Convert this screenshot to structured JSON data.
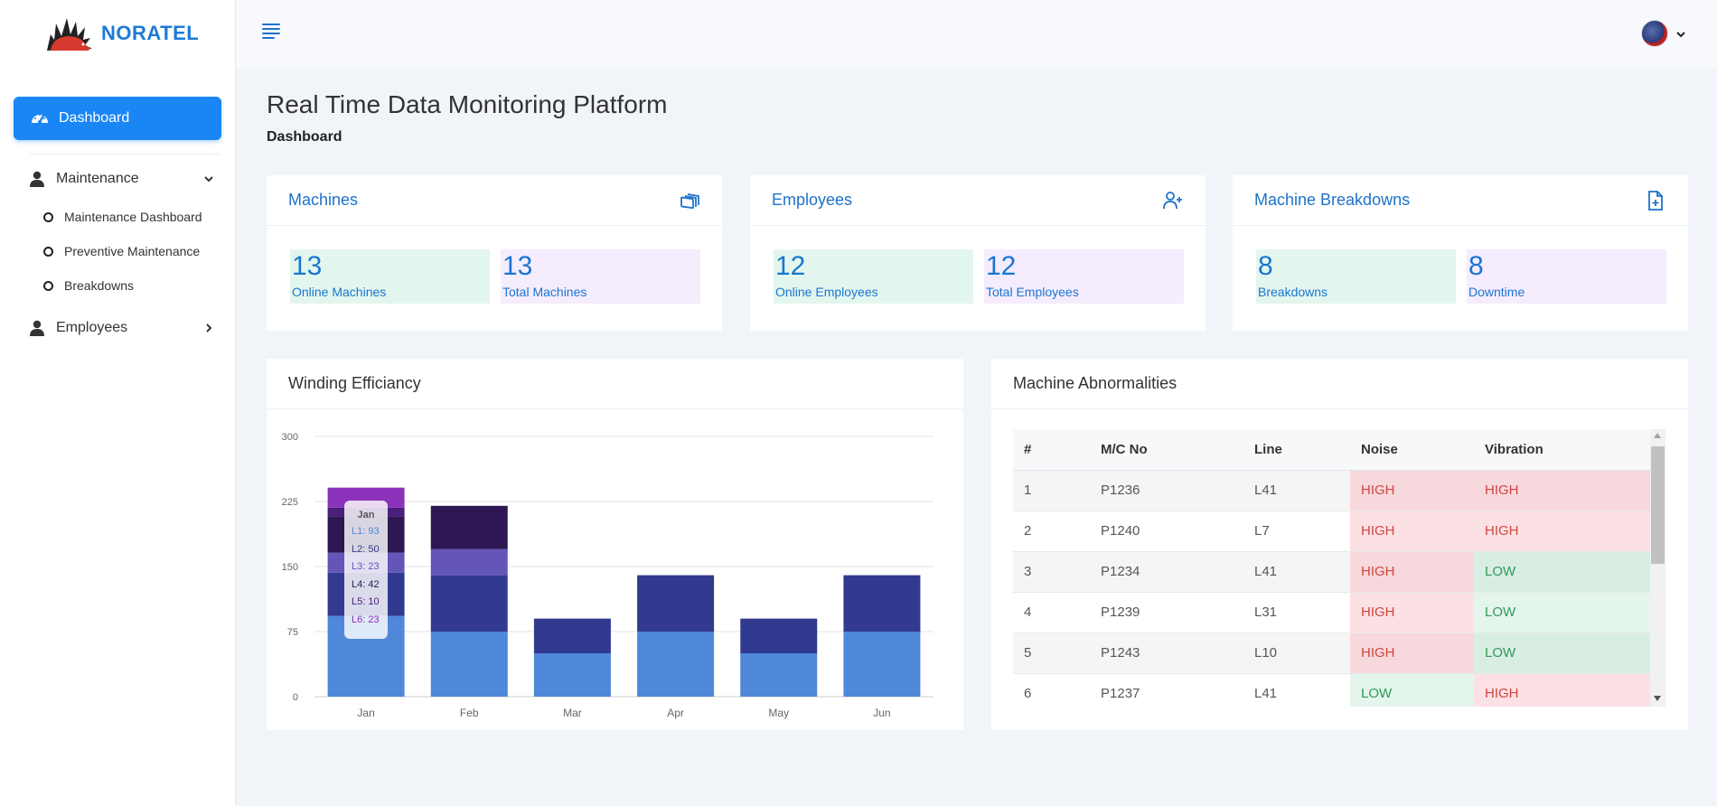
{
  "brand": {
    "name": "NORATEL"
  },
  "sidebar": {
    "active_label": "Dashboard",
    "maintenance": {
      "label": "Maintenance",
      "items": [
        "Maintenance Dashboard",
        "Preventive Maintenance",
        "Breakdowns"
      ]
    },
    "employees": {
      "label": "Employees"
    }
  },
  "page": {
    "title": "Real Time Data Monitoring Platform",
    "breadcrumb": "Dashboard"
  },
  "cards": [
    {
      "title": "Machines",
      "icon": "machines-icon",
      "stats": [
        {
          "value": "13",
          "label": "Online Machines"
        },
        {
          "value": "13",
          "label": "Total Machines"
        }
      ]
    },
    {
      "title": "Employees",
      "icon": "user-plus-icon",
      "stats": [
        {
          "value": "12",
          "label": "Online Employees"
        },
        {
          "value": "12",
          "label": "Total Employees"
        }
      ]
    },
    {
      "title": "Machine Breakdowns",
      "icon": "file-plus-icon",
      "stats": [
        {
          "value": "8",
          "label": "Breakdowns"
        },
        {
          "value": "8",
          "label": "Downtime"
        }
      ]
    }
  ],
  "winding": {
    "title": "Winding Efficiancy"
  },
  "chart_data": {
    "type": "bar",
    "stacked": true,
    "categories": [
      "Jan",
      "Feb",
      "Mar",
      "Apr",
      "May",
      "Jun"
    ],
    "ylim": [
      0,
      300
    ],
    "yticks": [
      0,
      75,
      150,
      225,
      300
    ],
    "grid": true,
    "series": [
      {
        "name": "L1",
        "color": "#4f87d9",
        "values": [
          93,
          75,
          50,
          75,
          50,
          75
        ]
      },
      {
        "name": "L2",
        "color": "#313a8f",
        "values": [
          50,
          65,
          40,
          65,
          40,
          65
        ]
      },
      {
        "name": "L3",
        "color": "#6455b9",
        "values": [
          23,
          30,
          0,
          0,
          0,
          0
        ]
      },
      {
        "name": "L4",
        "color": "#2e1752",
        "values": [
          42,
          50,
          0,
          0,
          0,
          0
        ]
      },
      {
        "name": "L5",
        "color": "#4a1e7a",
        "values": [
          10,
          0,
          0,
          0,
          0,
          0
        ]
      },
      {
        "name": "L6",
        "color": "#8a32b9",
        "values": [
          23,
          0,
          0,
          0,
          0,
          0
        ]
      }
    ],
    "tooltip": {
      "title": "Jan",
      "lines": [
        "L1: 93",
        "L2: 50",
        "L3: 23",
        "L4: 42",
        "L5: 10",
        "L6: 23"
      ]
    }
  },
  "abnormalities": {
    "title": "Machine Abnormalities",
    "columns": [
      "#",
      "M/C No",
      "Line",
      "Noise",
      "Vibration"
    ],
    "rows": [
      [
        "1",
        "P1236",
        "L41",
        "HIGH",
        "HIGH"
      ],
      [
        "2",
        "P1240",
        "L7",
        "HIGH",
        "HIGH"
      ],
      [
        "3",
        "P1234",
        "L41",
        "HIGH",
        "LOW"
      ],
      [
        "4",
        "P1239",
        "L31",
        "HIGH",
        "LOW"
      ],
      [
        "5",
        "P1243",
        "L10",
        "HIGH",
        "LOW"
      ],
      [
        "6",
        "P1237",
        "L41",
        "LOW",
        "HIGH"
      ]
    ]
  }
}
